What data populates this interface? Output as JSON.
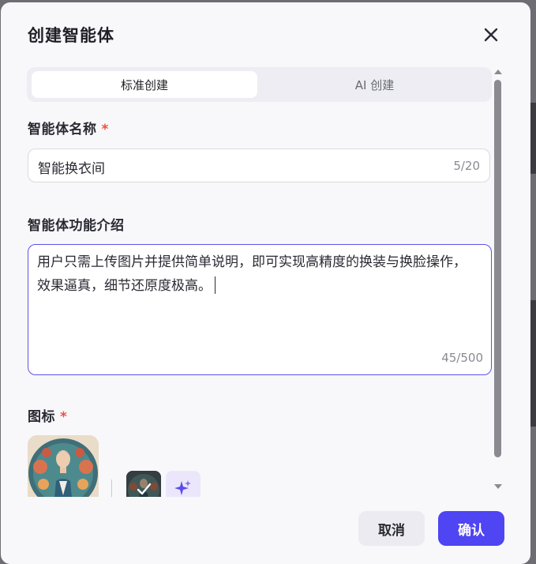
{
  "dialog": {
    "title": "创建智能体",
    "close_icon": "close-icon"
  },
  "tabs": [
    {
      "label": "标准创建",
      "active": true
    },
    {
      "label": "AI 创建",
      "active": false
    }
  ],
  "name_field": {
    "label": "智能体名称",
    "required_mark": "*",
    "value": "智能换衣间",
    "counter": "5/20"
  },
  "desc_field": {
    "label": "智能体功能介绍",
    "value": "用户只需上传图片并提供简单说明，即可实现高精度的换装与换脸操作，效果逼真，细节还原度极高。",
    "counter": "45/500"
  },
  "icon_field": {
    "label": "图标",
    "required_mark": "*",
    "ai_icon": "sparkle-icon",
    "selected_icon": "check-icon"
  },
  "footer": {
    "cancel_label": "取消",
    "confirm_label": "确认"
  },
  "colors": {
    "accent": "#4f45f2",
    "required": "#f0503c",
    "focus_border": "#5b52e8"
  }
}
